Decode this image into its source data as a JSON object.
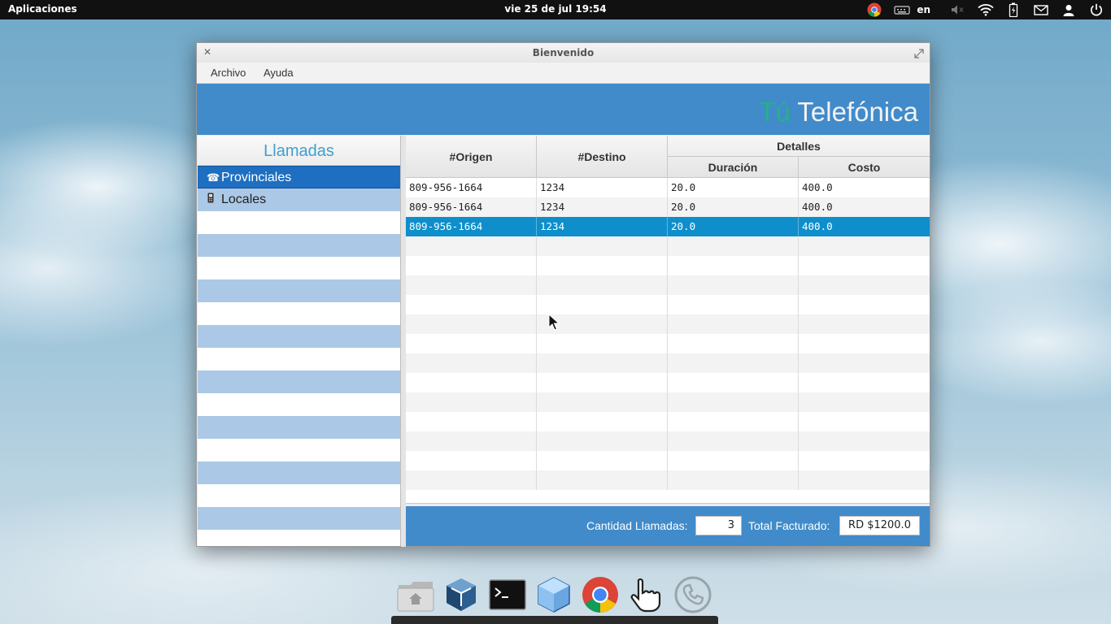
{
  "top_panel": {
    "apps_label": "Aplicaciones",
    "clock": "vie 25 de jul 19:54",
    "language": "en",
    "tray_icons": [
      "chrome-icon",
      "keyboard-icon",
      "volume-muted-icon",
      "wifi-icon",
      "battery-icon",
      "mail-icon",
      "user-icon",
      "power-icon"
    ]
  },
  "window": {
    "title": "Bienvenido",
    "menu": [
      "Archivo",
      "Ayuda"
    ]
  },
  "banner": {
    "brand_accent": "Tú",
    "brand_rest": "Telefónica",
    "accent_color": "#27b08a",
    "background_color": "#418bca"
  },
  "sidebar": {
    "heading": "Llamadas",
    "items": [
      {
        "label": "Provinciales",
        "icon": "telephone-icon",
        "selected": true
      },
      {
        "label": "Locales",
        "icon": "mobile-phone-icon",
        "selected": false
      }
    ]
  },
  "table": {
    "headers": {
      "origen": "#Origen",
      "destino": "#Destino",
      "detalles": "Detalles",
      "duracion": "Duración",
      "costo": "Costo"
    },
    "rows": [
      [
        "809-956-1664",
        "1234",
        "20.0",
        "400.0"
      ],
      [
        "809-956-1664",
        "1234",
        "20.0",
        "400.0"
      ],
      [
        "809-956-1664",
        "1234",
        "20.0",
        "400.0"
      ]
    ],
    "selected_row": 2,
    "selection_color": "#0e8fcb"
  },
  "footer": {
    "count_label": "Cantidad Llamadas:",
    "count_value": "3",
    "total_label": "Total Facturado:",
    "total_value": "RD $1200.0"
  },
  "dock": {
    "items": [
      "home-folder-icon",
      "virtualbox-icon",
      "terminal-icon",
      "3d-cube-icon",
      "chrome-icon",
      "touch-hand-icon",
      "phone-icon"
    ]
  }
}
